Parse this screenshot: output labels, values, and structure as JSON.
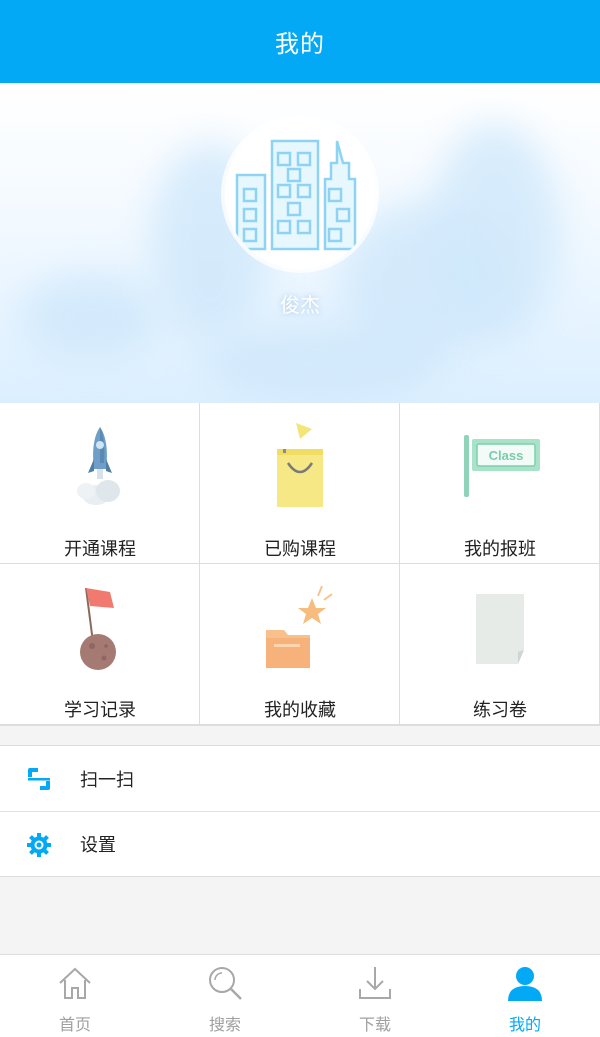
{
  "header": {
    "title": "我的"
  },
  "profile": {
    "username": "俊杰"
  },
  "grid": {
    "items": [
      {
        "label": "开通课程",
        "icon": "rocket-icon"
      },
      {
        "label": "已购课程",
        "icon": "shopping-bag-icon"
      },
      {
        "label": "我的报班",
        "icon": "class-sign-icon"
      },
      {
        "label": "学习记录",
        "icon": "flag-planet-icon"
      },
      {
        "label": "我的收藏",
        "icon": "folder-star-icon"
      },
      {
        "label": "练习卷",
        "icon": "paper-icon"
      }
    ],
    "sign_text": "Class"
  },
  "list": {
    "items": [
      {
        "label": "扫一扫",
        "icon": "scan-icon"
      },
      {
        "label": "设置",
        "icon": "gear-icon"
      }
    ]
  },
  "tabbar": {
    "tabs": [
      {
        "label": "首页",
        "icon": "home-icon",
        "active": false
      },
      {
        "label": "搜索",
        "icon": "search-icon",
        "active": false
      },
      {
        "label": "下载",
        "icon": "download-icon",
        "active": false
      },
      {
        "label": "我的",
        "icon": "user-icon",
        "active": true
      }
    ]
  },
  "colors": {
    "accent": "#03a9f4",
    "inactive": "#a0a0a0"
  }
}
